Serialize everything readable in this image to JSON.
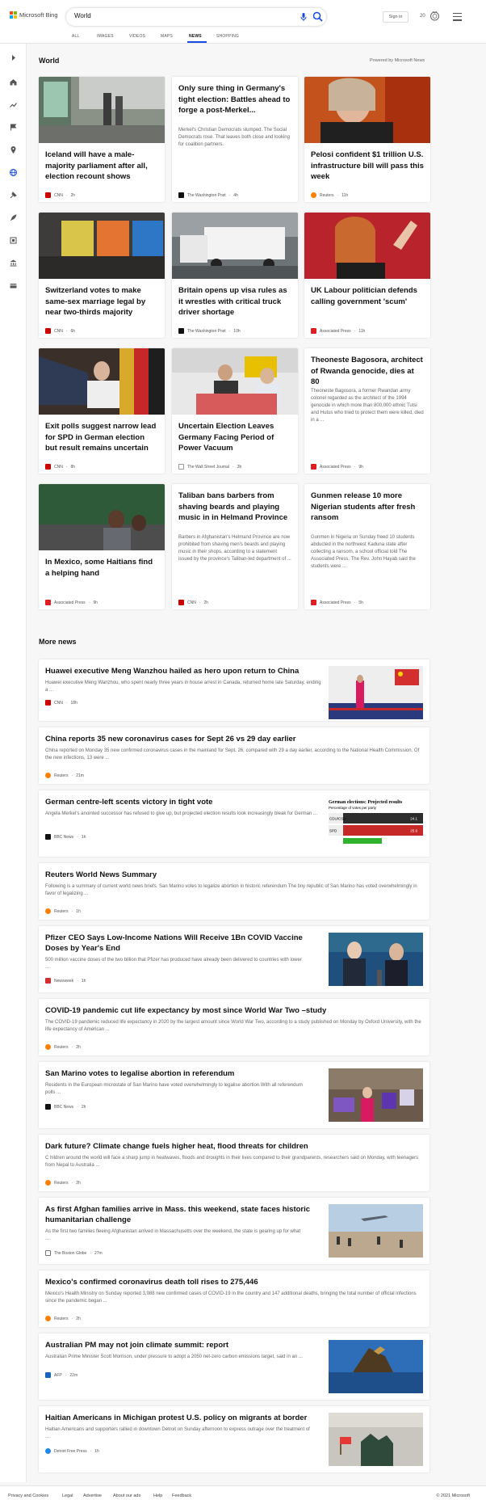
{
  "header": {
    "brand": "Microsoft Bing",
    "search_value": "World",
    "signin_label": "Sign in",
    "rewards_count": "20",
    "logo_colors": [
      "#f25022",
      "#7fba00",
      "#00a4ef",
      "#ffb900"
    ],
    "accent": "#174ae4"
  },
  "tabs": [
    {
      "label": "ALL"
    },
    {
      "label": "IMAGES"
    },
    {
      "label": "VIDEOS"
    },
    {
      "label": "MAPS"
    },
    {
      "label": "NEWS",
      "active": true
    },
    {
      "label": "SHOPPING"
    }
  ],
  "section": {
    "title": "World",
    "powered_by": "Powered by Microsoft News"
  },
  "cards": [
    {
      "title": "Iceland will have a male-majority parliament after all, election recount shows",
      "source": "CNN",
      "time": "2h",
      "has_image": true
    },
    {
      "title": "Only sure thing in Germany's tight election: Battles ahead to forge a post-Merkel...",
      "snippet": "Merkel's Christian Democrats slumped. The Social Democrats rose. That leaves both close and looking for coalition partners.",
      "source": "The Washington Post",
      "time": "4h",
      "has_image": false
    },
    {
      "title": "Pelosi confident $1 trillion U.S. infrastructure bill will pass this week",
      "source": "Reuters",
      "time": "11h",
      "has_image": true
    },
    {
      "title": "Switzerland votes to make same-sex marriage legal by near two-thirds majority",
      "source": "CNN",
      "time": "6h",
      "has_image": true
    },
    {
      "title": "Britain opens up visa rules as it wrestles with critical truck driver shortage",
      "source": "The Washington Post",
      "time": "10h",
      "has_image": true
    },
    {
      "title": "UK Labour politician defends calling government 'scum'",
      "source": "Associated Press",
      "time": "11h",
      "has_image": true
    },
    {
      "title": "Exit polls suggest narrow lead for SPD in German election but result remains uncertain",
      "source": "CNN",
      "time": "8h",
      "has_image": true
    },
    {
      "title": "Uncertain Election Leaves Germany Facing Period of Power Vacuum",
      "source": "The Wall Street Journal",
      "time": "3h",
      "has_image": true
    },
    {
      "title": "Theoneste Bagosora, architect of Rwanda genocide, dies at 80",
      "snippet": "Theoneste Bagosora, a former Rwandan army colonel regarded as the architect of the 1994 genocide in which more than 800,000 ethnic Tutsi and Hutus who tried to protect them were killed, died in a ...",
      "source": "Associated Press",
      "time": "9h",
      "has_image": false
    },
    {
      "title": "In Mexico, some Haitians find a helping hand",
      "source": "Associated Press",
      "time": "9h",
      "has_image": true
    },
    {
      "title": "Taliban bans barbers from shaving beards and playing music in in Helmand Province",
      "snippet": "Barbers in Afghanistan's Helmand Province are now prohibited from shaving men's beards and playing music in their shops, according to a statement issued by the province's Taliban-led department of ...",
      "source": "CNN",
      "time": "2h",
      "has_image": false
    },
    {
      "title": "Gunmen release 10 more Nigerian students after fresh ransom",
      "snippet": "Gunmen in Nigeria on Sunday freed 10 students abducted in the northwest Kaduna state after collecting a ransom, a school official told The Associated Press. The Rev. John Hayab said the students were ...",
      "source": "Associated Press",
      "time": "5h",
      "has_image": false
    }
  ],
  "more_news_title": "More news",
  "more_news": [
    {
      "title": "Huawei executive Meng Wanzhou hailed as hero upon return to China",
      "snippet": "Huawei executive Meng Wanzhou, who spent nearly three years in house arrest in Canada, returned home late Saturday, ending a ...",
      "source": "CNN",
      "time": "18h"
    },
    {
      "title": "China reports 35 new coronavirus cases for Sept 26 vs 29 day earlier",
      "snippet": "China reported on Monday 35 new confirmed coronavirus cases in the mainland for Sept. 26, compared with 29 a day earlier, according to the National Health Commission. Of the new infections, 13 were ...",
      "source": "Reuters",
      "time": "21m"
    },
    {
      "title": "German centre-left scents victory in tight vote",
      "snippet": "Angela Merkel's anointed successor has refused to give up, but projected election results look increasingly bleak for German ...",
      "source": "BBC News",
      "time": "1h",
      "chart": {
        "title": "German elections: Projected results",
        "subtitle": "Percentage of votes per party",
        "labels": [
          "CDU/CSU",
          "SPD",
          ""
        ],
        "value_labels": [
          "24.1",
          "25.9",
          ""
        ]
      }
    },
    {
      "title": "Reuters World News Summary",
      "snippet": "Following is a summary of current world news briefs. San Marino votes to legalize abortion in historic referendum The tiny republic of San Marino has voted overwhelmingly in favor of legalizing ...",
      "source": "Reuters",
      "time": "1h"
    },
    {
      "title": "Pfizer CEO Says Low-Income Nations Will Receive 1Bn COVID Vaccine Doses by Year's End",
      "snippet": "500 million vaccine doses of the two billion that Pfizer has produced have already been delivered to countries with lower ...",
      "source": "Newsweek",
      "time": "1h"
    },
    {
      "title": "COVID-19 pandemic cut life expectancy by most since World War Two –study",
      "snippet": "The COVID-19 pandemic reduced life expectancy in 2020 by the largest amount since World War Two, according to a study published on Monday by Oxford University, with the life expectancy of American ...",
      "source": "Reuters",
      "time": "2h"
    },
    {
      "title": "San Marino votes to legalise abortion in referendum",
      "snippet": "Residents in the European microstate of San Marino have voted overwhelmingly to legalise abortion.With all referendum polls ...",
      "source": "BBC News",
      "time": "2h"
    },
    {
      "title": "Dark future? Climate change fuels higher heat, flood threats for children",
      "snippet": "C hildren around the world will face a sharp jump in heatwaves, floods and droughts in their lives compared to their grandparents, researchers said on Monday, with teenagers from Nepal to Australia ...",
      "source": "Reuters",
      "time": "2h"
    },
    {
      "title": "As first Afghan families arrive in Mass. this weekend, state faces historic humanitarian challenge",
      "snippet": "As the first two families fleeing Afghanistan arrived in Massachusetts over the weekend, the state is gearing up for what ...",
      "source": "The Boston Globe",
      "time": "27m"
    },
    {
      "title": "Mexico's confirmed coronavirus death toll rises to 275,446",
      "snippet": "Mexico's Health Ministry on Sunday reported 3,988 new confirmed cases of COVID-19 in the country and 147 additional deaths, bringing the total number of official infections since the pandemic began ...",
      "source": "Reuters",
      "time": "2h"
    },
    {
      "title": "Australian PM may not join climate summit: report",
      "snippet": "Australian Prime Minister Scott Morrison, under pressure to adopt a 2050 net-zero carbon emissions target, said in an ...",
      "source": "AFP",
      "time": "22m"
    },
    {
      "title": "Haitian Americans in Michigan protest U.S. policy on migrants at border",
      "snippet": "Haitian Americans and supporters rallied in downtown Detroit on Sunday afternoon to express outrage over the treatment of ...",
      "source": "Detroit Free Press",
      "time": "1h"
    }
  ],
  "footer": {
    "links": [
      "Privacy and Cookies",
      "Legal",
      "Advertise",
      "About our ads",
      "Help",
      "Feedback"
    ],
    "copyright": "© 2021 Microsoft"
  }
}
